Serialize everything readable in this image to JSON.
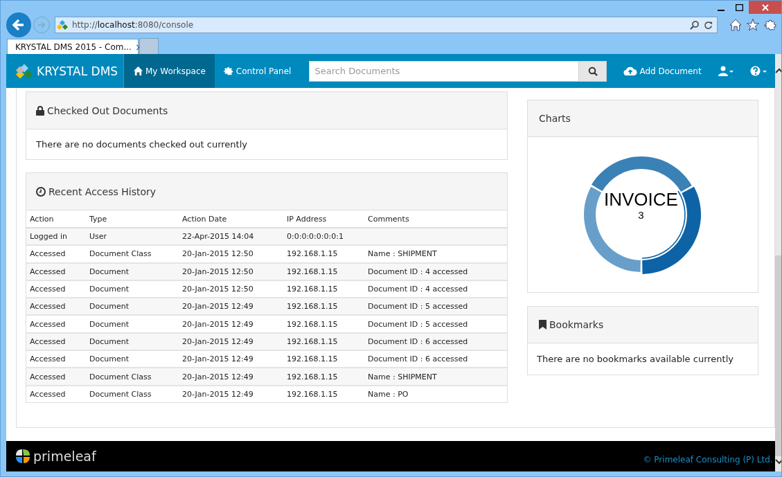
{
  "browser": {
    "address": {
      "prefix": "http://",
      "host": "localhost",
      "rest": ":8080/console"
    },
    "tab_title": "KRYSTAL DMS 2015 - Com...",
    "tab_close": "×"
  },
  "navbar": {
    "brand": "KRYSTAL DMS",
    "items": [
      {
        "label": "My Workspace",
        "selected": true
      },
      {
        "label": "Control Panel",
        "selected": false
      }
    ],
    "search": {
      "placeholder": "Search Documents"
    },
    "add_document": "Add Document"
  },
  "checked_out": {
    "title": "Checked Out Documents",
    "message": "There are no documents checked out currently"
  },
  "history": {
    "title": "Recent Access History",
    "columns": [
      "Action",
      "Type",
      "Action Date",
      "IP Address",
      "Comments"
    ],
    "rows": [
      [
        "Logged in",
        "User",
        "22-Apr-2015 14:04",
        "0:0:0:0:0:0:0:1",
        ""
      ],
      [
        "Accessed",
        "Document Class",
        "20-Jan-2015 12:50",
        "192.168.1.15",
        "Name : SHIPMENT"
      ],
      [
        "Accessed",
        "Document",
        "20-Jan-2015 12:50",
        "192.168.1.15",
        "Document ID : 4 accessed"
      ],
      [
        "Accessed",
        "Document",
        "20-Jan-2015 12:50",
        "192.168.1.15",
        "Document ID : 4 accessed"
      ],
      [
        "Accessed",
        "Document",
        "20-Jan-2015 12:49",
        "192.168.1.15",
        "Document ID : 5 accessed"
      ],
      [
        "Accessed",
        "Document",
        "20-Jan-2015 12:49",
        "192.168.1.15",
        "Document ID : 5 accessed"
      ],
      [
        "Accessed",
        "Document",
        "20-Jan-2015 12:49",
        "192.168.1.15",
        "Document ID : 6 accessed"
      ],
      [
        "Accessed",
        "Document",
        "20-Jan-2015 12:49",
        "192.168.1.15",
        "Document ID : 6 accessed"
      ],
      [
        "Accessed",
        "Document Class",
        "20-Jan-2015 12:49",
        "192.168.1.15",
        "Name : SHIPMENT"
      ],
      [
        "Accessed",
        "Document Class",
        "20-Jan-2015 12:49",
        "192.168.1.15",
        "Name : PO"
      ]
    ]
  },
  "charts": {
    "title": "Charts",
    "center_label": "INVOICE",
    "center_value": "3"
  },
  "bookmarks": {
    "title": "Bookmarks",
    "message": "There are no bookmarks available currently"
  },
  "footer": {
    "brand": "primeleaf",
    "copyright": "© Primeleaf Consulting (P) Ltd."
  }
}
